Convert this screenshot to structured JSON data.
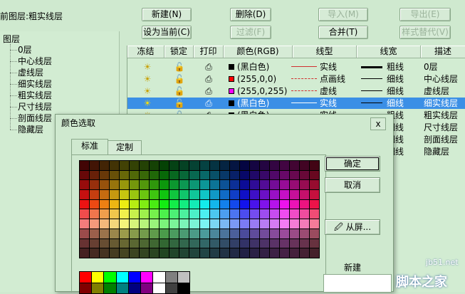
{
  "current_layer_label": "前图层:粗实线层",
  "toolbar": {
    "row1": [
      {
        "name": "new-button",
        "label": "新建(N)",
        "disabled": false
      },
      {
        "name": "delete-button",
        "label": "删除(D)",
        "disabled": false
      },
      {
        "name": "import-button",
        "label": "导入(M)",
        "disabled": true
      },
      {
        "name": "export-button",
        "label": "导出(E)",
        "disabled": true
      }
    ],
    "row2": [
      {
        "name": "set-current-button",
        "label": "设为当前(C)",
        "disabled": false
      },
      {
        "name": "filter-button",
        "label": "过滤(F)",
        "disabled": true
      },
      {
        "name": "merge-button",
        "label": "合并(T)",
        "disabled": false
      },
      {
        "name": "style-replace-button",
        "label": "样式替代(V)",
        "disabled": true
      }
    ]
  },
  "tree": {
    "root": "图层",
    "items": [
      "0层",
      "中心线层",
      "虚线层",
      "细实线层",
      "粗实线层",
      "尺寸线层",
      "剖面线层",
      "隐藏层"
    ]
  },
  "table": {
    "headers": [
      "冻结",
      "锁定",
      "打印",
      "颜色(RGB)",
      "线型",
      "线宽",
      "描述"
    ],
    "rows": [
      {
        "color_text": "(黑白色)",
        "swatch": "#000000",
        "linetype": "实线",
        "line_color": "#d03030",
        "line_style": "solid",
        "width_text": "粗线",
        "width_weight": 3,
        "desc": "0层",
        "selected": false
      },
      {
        "color_text": "(255,0,0)",
        "swatch": "#ff0000",
        "linetype": "点画线",
        "line_color": "#d03030",
        "line_style": "dashdot",
        "width_text": "细线",
        "width_weight": 1,
        "desc": "中心线层",
        "selected": false
      },
      {
        "color_text": "(255,0,255)",
        "swatch": "#ff00ff",
        "linetype": "虚线",
        "line_color": "#d03030",
        "line_style": "dashed",
        "width_text": "细线",
        "width_weight": 1,
        "desc": "虚线层",
        "selected": false
      },
      {
        "color_text": "(黑白色)",
        "swatch": "#000000",
        "linetype": "实线",
        "line_color": "#ffffff",
        "line_style": "solid",
        "width_text": "细线",
        "width_weight": 1,
        "desc": "细实线层",
        "selected": true
      },
      {
        "color_text": "(黑白色)",
        "swatch": "#000000",
        "linetype": "实线",
        "line_color": "#d03030",
        "line_style": "solid",
        "width_text": "粗线",
        "width_weight": 1,
        "desc": "粗实线层",
        "selected": false
      },
      {
        "color_text": "",
        "swatch": "#00aa00",
        "linetype": "",
        "line_color": "#d03030",
        "line_style": "solid",
        "width_text": "细线",
        "width_weight": 1,
        "desc": "尺寸线层",
        "selected": false
      },
      {
        "color_text": "",
        "swatch": "",
        "linetype": "",
        "line_color": "#d03030",
        "line_style": "solid",
        "width_text": "细线",
        "width_weight": 1,
        "desc": "剖面线层",
        "selected": false
      },
      {
        "color_text": "",
        "swatch": "",
        "linetype": "",
        "line_color": "#d03030",
        "line_style": "solid",
        "width_text": "细线",
        "width_weight": 1,
        "desc": "隐藏层",
        "selected": false
      }
    ]
  },
  "dialog": {
    "title": "颜色选取",
    "close_label": "x",
    "tabs": [
      "标准",
      "定制"
    ],
    "ok_label": "确定",
    "cancel_label": "取消",
    "pick_label": "从屏...",
    "new_label": "新建",
    "basic_colors": [
      "#ff0000",
      "#ffff00",
      "#00ff00",
      "#00ffff",
      "#0000ff",
      "#ff00ff",
      "#ffffff",
      "#808080",
      "#c0c0c0",
      "#800000",
      "#808000",
      "#008000",
      "#008080",
      "#000080",
      "#800080",
      "#ffffff",
      "#404040",
      "#000000"
    ]
  },
  "watermark": {
    "site": "jb51.net",
    "brand": "脚本之家"
  }
}
